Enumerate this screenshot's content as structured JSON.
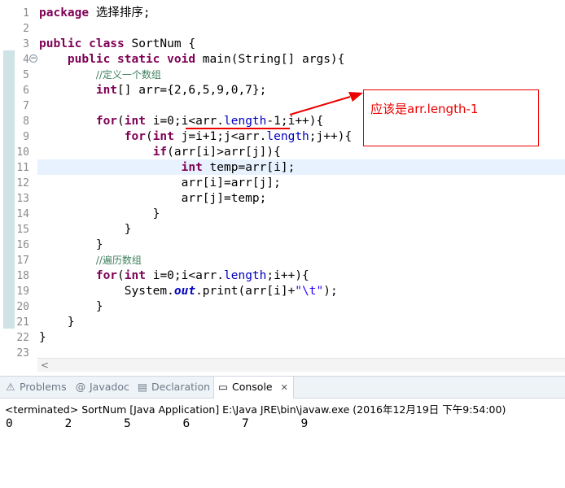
{
  "editor": {
    "lines": [
      {
        "n": "1",
        "segs": [
          {
            "c": "kw",
            "t": "package"
          },
          {
            "c": "",
            "t": " 选择排序;"
          }
        ]
      },
      {
        "n": "2",
        "segs": []
      },
      {
        "n": "3",
        "segs": [
          {
            "c": "kw",
            "t": "public class"
          },
          {
            "c": "",
            "t": " SortNum {"
          }
        ]
      },
      {
        "n": "4",
        "segs": [
          {
            "c": "",
            "t": "    "
          },
          {
            "c": "kw",
            "t": "public static void"
          },
          {
            "c": "",
            "t": " main(String[] args){"
          }
        ]
      },
      {
        "n": "5",
        "segs": [
          {
            "c": "",
            "t": "        "
          },
          {
            "c": "cm",
            "t": "//定义一个数组"
          }
        ]
      },
      {
        "n": "6",
        "segs": [
          {
            "c": "",
            "t": "        "
          },
          {
            "c": "kw",
            "t": "int"
          },
          {
            "c": "",
            "t": "[] arr={2,6,5,9,0,7};"
          }
        ]
      },
      {
        "n": "7",
        "segs": []
      },
      {
        "n": "8",
        "segs": [
          {
            "c": "",
            "t": "        "
          },
          {
            "c": "kw",
            "t": "for"
          },
          {
            "c": "",
            "t": "("
          },
          {
            "c": "kw",
            "t": "int"
          },
          {
            "c": "",
            "t": " i=0;i<arr."
          },
          {
            "c": "fld",
            "t": "length"
          },
          {
            "c": "",
            "t": "-1;i++){"
          }
        ]
      },
      {
        "n": "9",
        "segs": [
          {
            "c": "",
            "t": "            "
          },
          {
            "c": "kw",
            "t": "for"
          },
          {
            "c": "",
            "t": "("
          },
          {
            "c": "kw",
            "t": "int"
          },
          {
            "c": "",
            "t": " j=i+1;j<arr."
          },
          {
            "c": "fld",
            "t": "length"
          },
          {
            "c": "",
            "t": ";j++){"
          }
        ]
      },
      {
        "n": "10",
        "segs": [
          {
            "c": "",
            "t": "                "
          },
          {
            "c": "kw",
            "t": "if"
          },
          {
            "c": "",
            "t": "(arr[i]>arr[j]){"
          }
        ]
      },
      {
        "n": "11",
        "segs": [
          {
            "c": "",
            "t": "                    "
          },
          {
            "c": "kw",
            "t": "int"
          },
          {
            "c": "",
            "t": " temp=arr[i];"
          }
        ]
      },
      {
        "n": "12",
        "segs": [
          {
            "c": "",
            "t": "                    arr[i]=arr[j];"
          }
        ]
      },
      {
        "n": "13",
        "segs": [
          {
            "c": "",
            "t": "                    arr[j]=temp;"
          }
        ]
      },
      {
        "n": "14",
        "segs": [
          {
            "c": "",
            "t": "                }"
          }
        ]
      },
      {
        "n": "15",
        "segs": [
          {
            "c": "",
            "t": "            }"
          }
        ]
      },
      {
        "n": "16",
        "segs": [
          {
            "c": "",
            "t": "        }"
          }
        ]
      },
      {
        "n": "17",
        "segs": [
          {
            "c": "",
            "t": "        "
          },
          {
            "c": "cm",
            "t": "//遍历数组"
          }
        ]
      },
      {
        "n": "18",
        "segs": [
          {
            "c": "",
            "t": "        "
          },
          {
            "c": "kw",
            "t": "for"
          },
          {
            "c": "",
            "t": "("
          },
          {
            "c": "kw",
            "t": "int"
          },
          {
            "c": "",
            "t": " i=0;i<arr."
          },
          {
            "c": "fld",
            "t": "length"
          },
          {
            "c": "",
            "t": ";i++){"
          }
        ]
      },
      {
        "n": "19",
        "segs": [
          {
            "c": "",
            "t": "            System."
          },
          {
            "c": "it",
            "t": "out"
          },
          {
            "c": "",
            "t": ".print(arr[i]+"
          },
          {
            "c": "st",
            "t": "\"\\t\""
          },
          {
            "c": "",
            "t": ");"
          }
        ]
      },
      {
        "n": "20",
        "segs": [
          {
            "c": "",
            "t": "        }"
          }
        ]
      },
      {
        "n": "21",
        "segs": [
          {
            "c": "",
            "t": "    }"
          }
        ]
      },
      {
        "n": "22",
        "segs": [
          {
            "c": "",
            "t": "}"
          }
        ]
      },
      {
        "n": "23",
        "segs": []
      }
    ],
    "fold_symbols": {
      "l4": "−"
    }
  },
  "annotation": {
    "text": "应该是arr.length-1",
    "color": "#ee0000"
  },
  "panel": {
    "tabs": [
      {
        "icon": "problems-icon",
        "glyph": "⚠",
        "label": "Problems"
      },
      {
        "icon": "javadoc-icon",
        "glyph": "@",
        "label": "Javadoc"
      },
      {
        "icon": "declaration-icon",
        "glyph": "▤",
        "label": "Declaration"
      },
      {
        "icon": "console-icon",
        "glyph": "▭",
        "label": "Console",
        "active": true,
        "close": "✕"
      }
    ],
    "status": "<terminated> SortNum [Java Application] E:\\Java JRE\\bin\\javaw.exe (2016年12月19日 下午9:54:00)",
    "output": [
      "0",
      "2",
      "5",
      "6",
      "7",
      "9"
    ]
  },
  "scroll_left": "<"
}
